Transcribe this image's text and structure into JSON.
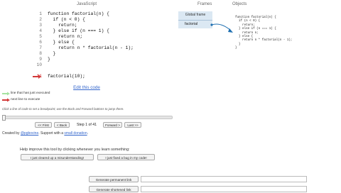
{
  "code_panel": {
    "language_label": "JavaScript",
    "lines": [
      {
        "num": "1",
        "text": "function factorial(n) {"
      },
      {
        "num": "2",
        "text": "  if (n < 0) {"
      },
      {
        "num": "3",
        "text": "    return;"
      },
      {
        "num": "4",
        "text": "  } else if (n === 1) {"
      },
      {
        "num": "5",
        "text": "    return n;"
      },
      {
        "num": "6",
        "text": "  } else {"
      },
      {
        "num": "7",
        "text": "    return n * factorial(n - 1);"
      },
      {
        "num": "8",
        "text": "  }"
      },
      {
        "num": "9",
        "text": "}"
      },
      {
        "num": "10",
        "text": ""
      },
      {
        "num": "11",
        "text": "factorial(10);"
      }
    ],
    "edit_link": "Edit this code"
  },
  "legend": {
    "executed": "line that has just executed",
    "next": "next line to execute",
    "breakpoint_hint": "Click a line of code to set a breakpoint; use the Back and Forward buttons to jump there."
  },
  "navigation": {
    "first": "<< First",
    "back": "< Back",
    "step": "Step 1 of 41",
    "forward": "Forward >",
    "last": "Last >>"
  },
  "credits": {
    "prefix": "Created by ",
    "author": "@pgbovine",
    "middle": ". Support with a ",
    "donation": "small donation",
    "suffix": "."
  },
  "feedback": {
    "prompt": "Help improve this tool by clicking whenever you learn something:",
    "misunderstanding": "I just cleared up a misunderstanding!",
    "bug": "I just fixed a bug in my code!"
  },
  "links": {
    "permanent": "Generate permanent link",
    "shortened": "Generate shortened link"
  },
  "visualizer": {
    "frames_header": "Frames",
    "objects_header": "Objects",
    "global_frame": "Global frame",
    "frame_var": "factorial",
    "function_object": [
      "function factorial(n) {",
      "  if (n < 0) {",
      "    return;",
      "  } else if (n === 1) {",
      "    return n;",
      "  } else {",
      "    return n * factorial(n - 1);",
      "  }",
      "}"
    ]
  },
  "colors": {
    "executed_arrow": "#a6e3a1",
    "next_arrow": "#d23a3a",
    "link": "#3366cc",
    "frame_bg": "#dbe8f3"
  }
}
